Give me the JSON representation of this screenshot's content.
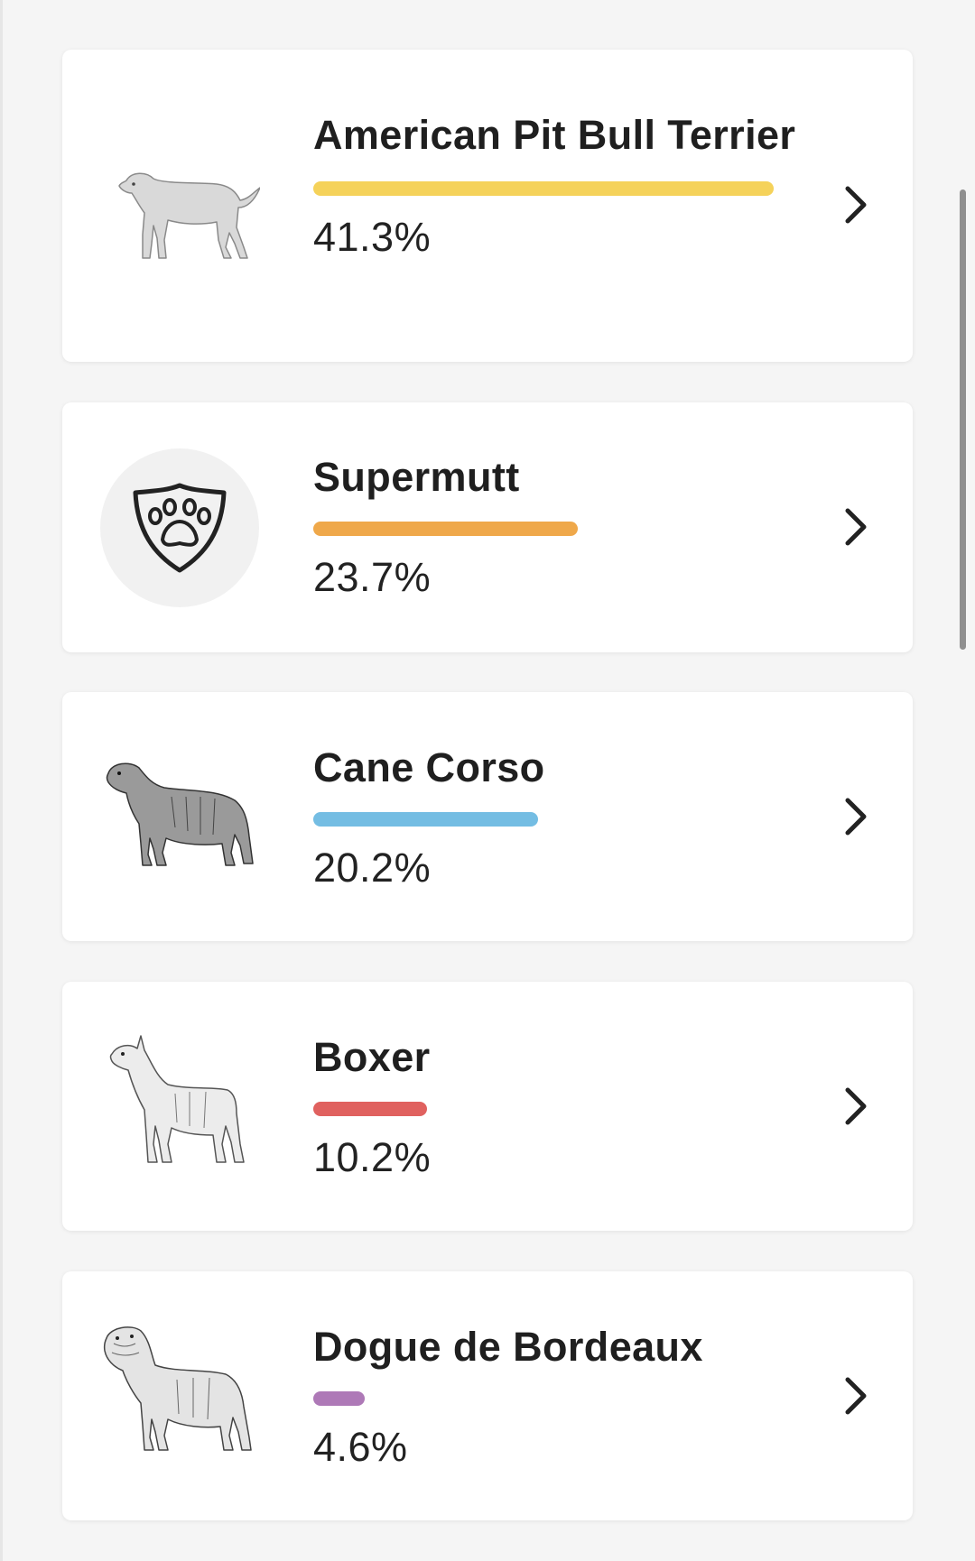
{
  "breeds": [
    {
      "name": "American Pit Bull Terrier",
      "percent_label": "41.3%",
      "percent": 41.3,
      "bar_color": "#f5d25a",
      "icon": "dog-illustration-icon"
    },
    {
      "name": "Supermutt",
      "percent_label": "23.7%",
      "percent": 23.7,
      "bar_color": "#efa84a",
      "icon": "paw-shield-icon"
    },
    {
      "name": "Cane Corso",
      "percent_label": "20.2%",
      "percent": 20.2,
      "bar_color": "#74bde3",
      "icon": "dog-illustration-icon"
    },
    {
      "name": "Boxer",
      "percent_label": "10.2%",
      "percent": 10.2,
      "bar_color": "#e0615f",
      "icon": "dog-illustration-icon"
    },
    {
      "name": "Dogue de Bordeaux",
      "percent_label": "4.6%",
      "percent": 4.6,
      "bar_color": "#ae79b7",
      "icon": "dog-illustration-icon"
    }
  ]
}
